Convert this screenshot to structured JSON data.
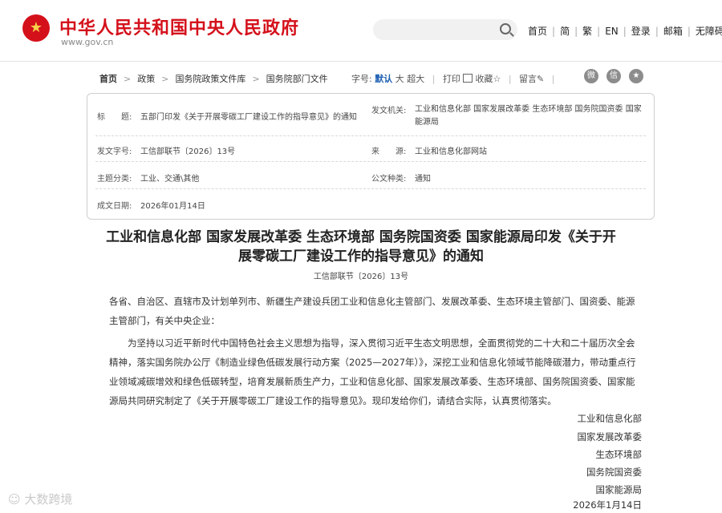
{
  "header": {
    "site_name": "中华人民共和国中央人民政府",
    "site_url": "www.gov.cn",
    "nav": [
      "首页",
      "简",
      "繁",
      "EN",
      "登录",
      "邮箱",
      "无障碍"
    ]
  },
  "breadcrumb": [
    "首页",
    "政策",
    "国务院政策文件库",
    "国务院部门文件"
  ],
  "tools": {
    "font_label": "字号:",
    "font_default": "默认",
    "font_large": "大",
    "font_xlarge": "超大",
    "print": "打印",
    "favorite": "收藏",
    "comment": "留言"
  },
  "meta": {
    "title_label": "标　　题:",
    "title_value": "五部门印发《关于开展零碳工厂建设工作的指导意见》的通知",
    "issuer_label": "发文机关:",
    "issuer_value": "工业和信息化部 国家发展改革委 生态环境部 国务院国资委 国家能源局",
    "docno_label": "发文字号:",
    "docno_value": "工信部联节〔2026〕13号",
    "source_label": "来　　源:",
    "source_value": "工业和信息化部网站",
    "topic_label": "主题分类:",
    "topic_value": "工业、交通\\其他",
    "type_label": "公文种类:",
    "type_value": "通知",
    "date_label": "成文日期:",
    "date_value": "2026年01月14日"
  },
  "article": {
    "title": "工业和信息化部 国家发展改革委 生态环境部 国务院国资委 国家能源局印发《关于开展零碳工厂建设工作的指导意见》的通知",
    "doc_number": "工信部联节〔2026〕13号",
    "para1": "各省、自治区、直辖市及计划单列市、新疆生产建设兵团工业和信息化主管部门、发展改革委、生态环境主管部门、国资委、能源主管部门，有关中央企业：",
    "para2": "为坚持以习近平新时代中国特色社会主义思想为指导，深入贯彻习近平生态文明思想，全面贯彻党的二十大和二十届历次全会精神，落实国务院办公厅《制造业绿色低碳发展行动方案（2025—2027年）》，深挖工业和信息化领域节能降碳潜力，带动重点行业领域减碳增效和绿色低碳转型，培育发展新质生产力，工业和信息化部、国家发展改革委、生态环境部、国务院国资委、国家能源局共同研究制定了《关于开展零碳工厂建设工作的指导意见》。现印发给你们，请结合实际，认真贯彻落实。",
    "signatures": [
      "工业和信息化部",
      "国家发展改革委",
      "生态环境部",
      "国务院国资委",
      "国家能源局"
    ],
    "sign_date": "2026年1月14日"
  },
  "watermark": "大数跨境"
}
